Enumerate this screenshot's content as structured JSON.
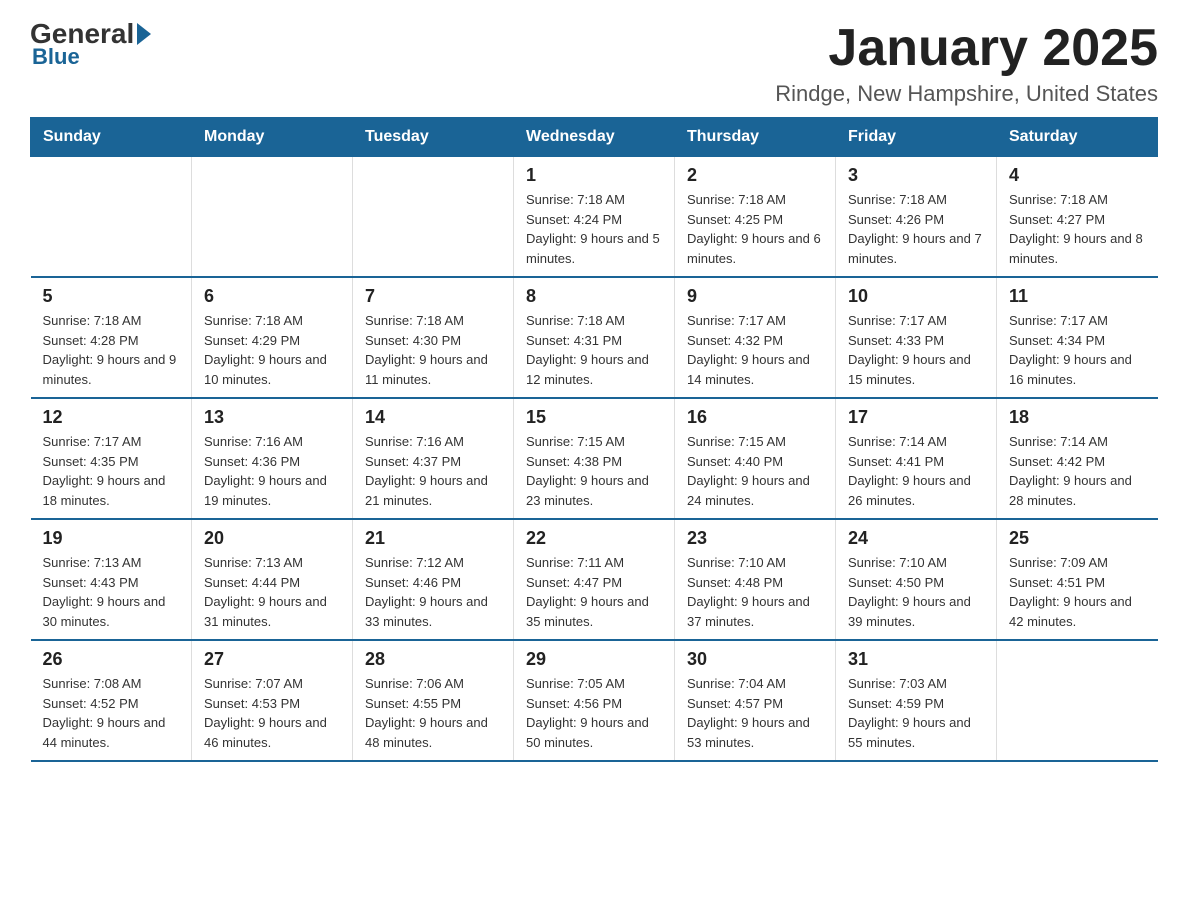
{
  "header": {
    "logo": {
      "general": "General",
      "blue": "Blue"
    },
    "title": "January 2025",
    "subtitle": "Rindge, New Hampshire, United States"
  },
  "weekdays": [
    "Sunday",
    "Monday",
    "Tuesday",
    "Wednesday",
    "Thursday",
    "Friday",
    "Saturday"
  ],
  "weeks": [
    [
      {
        "day": "",
        "info": ""
      },
      {
        "day": "",
        "info": ""
      },
      {
        "day": "",
        "info": ""
      },
      {
        "day": "1",
        "info": "Sunrise: 7:18 AM\nSunset: 4:24 PM\nDaylight: 9 hours and 5 minutes."
      },
      {
        "day": "2",
        "info": "Sunrise: 7:18 AM\nSunset: 4:25 PM\nDaylight: 9 hours and 6 minutes."
      },
      {
        "day": "3",
        "info": "Sunrise: 7:18 AM\nSunset: 4:26 PM\nDaylight: 9 hours and 7 minutes."
      },
      {
        "day": "4",
        "info": "Sunrise: 7:18 AM\nSunset: 4:27 PM\nDaylight: 9 hours and 8 minutes."
      }
    ],
    [
      {
        "day": "5",
        "info": "Sunrise: 7:18 AM\nSunset: 4:28 PM\nDaylight: 9 hours and 9 minutes."
      },
      {
        "day": "6",
        "info": "Sunrise: 7:18 AM\nSunset: 4:29 PM\nDaylight: 9 hours and 10 minutes."
      },
      {
        "day": "7",
        "info": "Sunrise: 7:18 AM\nSunset: 4:30 PM\nDaylight: 9 hours and 11 minutes."
      },
      {
        "day": "8",
        "info": "Sunrise: 7:18 AM\nSunset: 4:31 PM\nDaylight: 9 hours and 12 minutes."
      },
      {
        "day": "9",
        "info": "Sunrise: 7:17 AM\nSunset: 4:32 PM\nDaylight: 9 hours and 14 minutes."
      },
      {
        "day": "10",
        "info": "Sunrise: 7:17 AM\nSunset: 4:33 PM\nDaylight: 9 hours and 15 minutes."
      },
      {
        "day": "11",
        "info": "Sunrise: 7:17 AM\nSunset: 4:34 PM\nDaylight: 9 hours and 16 minutes."
      }
    ],
    [
      {
        "day": "12",
        "info": "Sunrise: 7:17 AM\nSunset: 4:35 PM\nDaylight: 9 hours and 18 minutes."
      },
      {
        "day": "13",
        "info": "Sunrise: 7:16 AM\nSunset: 4:36 PM\nDaylight: 9 hours and 19 minutes."
      },
      {
        "day": "14",
        "info": "Sunrise: 7:16 AM\nSunset: 4:37 PM\nDaylight: 9 hours and 21 minutes."
      },
      {
        "day": "15",
        "info": "Sunrise: 7:15 AM\nSunset: 4:38 PM\nDaylight: 9 hours and 23 minutes."
      },
      {
        "day": "16",
        "info": "Sunrise: 7:15 AM\nSunset: 4:40 PM\nDaylight: 9 hours and 24 minutes."
      },
      {
        "day": "17",
        "info": "Sunrise: 7:14 AM\nSunset: 4:41 PM\nDaylight: 9 hours and 26 minutes."
      },
      {
        "day": "18",
        "info": "Sunrise: 7:14 AM\nSunset: 4:42 PM\nDaylight: 9 hours and 28 minutes."
      }
    ],
    [
      {
        "day": "19",
        "info": "Sunrise: 7:13 AM\nSunset: 4:43 PM\nDaylight: 9 hours and 30 minutes."
      },
      {
        "day": "20",
        "info": "Sunrise: 7:13 AM\nSunset: 4:44 PM\nDaylight: 9 hours and 31 minutes."
      },
      {
        "day": "21",
        "info": "Sunrise: 7:12 AM\nSunset: 4:46 PM\nDaylight: 9 hours and 33 minutes."
      },
      {
        "day": "22",
        "info": "Sunrise: 7:11 AM\nSunset: 4:47 PM\nDaylight: 9 hours and 35 minutes."
      },
      {
        "day": "23",
        "info": "Sunrise: 7:10 AM\nSunset: 4:48 PM\nDaylight: 9 hours and 37 minutes."
      },
      {
        "day": "24",
        "info": "Sunrise: 7:10 AM\nSunset: 4:50 PM\nDaylight: 9 hours and 39 minutes."
      },
      {
        "day": "25",
        "info": "Sunrise: 7:09 AM\nSunset: 4:51 PM\nDaylight: 9 hours and 42 minutes."
      }
    ],
    [
      {
        "day": "26",
        "info": "Sunrise: 7:08 AM\nSunset: 4:52 PM\nDaylight: 9 hours and 44 minutes."
      },
      {
        "day": "27",
        "info": "Sunrise: 7:07 AM\nSunset: 4:53 PM\nDaylight: 9 hours and 46 minutes."
      },
      {
        "day": "28",
        "info": "Sunrise: 7:06 AM\nSunset: 4:55 PM\nDaylight: 9 hours and 48 minutes."
      },
      {
        "day": "29",
        "info": "Sunrise: 7:05 AM\nSunset: 4:56 PM\nDaylight: 9 hours and 50 minutes."
      },
      {
        "day": "30",
        "info": "Sunrise: 7:04 AM\nSunset: 4:57 PM\nDaylight: 9 hours and 53 minutes."
      },
      {
        "day": "31",
        "info": "Sunrise: 7:03 AM\nSunset: 4:59 PM\nDaylight: 9 hours and 55 minutes."
      },
      {
        "day": "",
        "info": ""
      }
    ]
  ]
}
